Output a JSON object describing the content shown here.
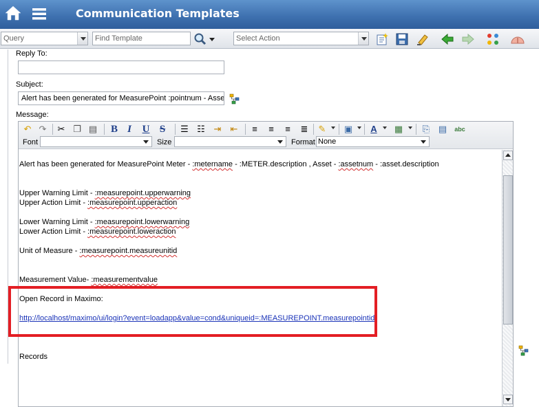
{
  "app": {
    "title": "Communication Templates",
    "home_icon": "home-icon",
    "menu_icon": "hamburger-menu-icon"
  },
  "toolbar": {
    "query_placeholder": "Query",
    "find_placeholder": "Find Template",
    "action_placeholder": "Select Action"
  },
  "form": {
    "reply_to_label": "Reply To:",
    "reply_to_value": "",
    "subject_label": "Subject:",
    "subject_value": "Alert has been generated for MeasurePoint :pointnum - Asset",
    "message_label": "Message:"
  },
  "editor": {
    "font_label": "Font",
    "font_value": "",
    "size_label": "Size",
    "size_value": "",
    "format_label": "Format",
    "format_value": "None",
    "body": {
      "line1_prefix": "Alert has been generated for MeasurePoint Meter - ",
      "line1_metername": ":metername",
      "line1_mid": " - :METER.description  , Asset - ",
      "line1_assetnum": ":assetnum",
      "line1_suffix": " - :asset.description",
      "upper_warning_label": "Upper Warning Limit - ",
      "upper_warning_var": ":measurepoint.upperwarning",
      "upper_action_label": "Upper Action Limit - ",
      "upper_action_var": ":measurepoint.upperaction",
      "lower_warning_label": "Lower Warning Limit - ",
      "lower_warning_var": ":measurepoint.lowerwarning",
      "lower_action_label": "Lower Action Limit - ",
      "lower_action_var": ":measurepoint.loweraction",
      "uom_label": "Unit of Measure - ",
      "uom_var": ":measurepoint.measureunitid",
      "mv_label": "Measurement Value- ",
      "mv_var": ":measurementvalue",
      "open_record": "Open Record in Maximo:",
      "link": "http://localhost/maximo/ui/login?event=loadapp&value=cond&uniqueid=:MEASUREPOINT.measurepointid",
      "records": "Records"
    }
  },
  "colors": {
    "highlight": "#e31e24",
    "titlebar": "#3d6fae",
    "link": "#1a33b8"
  }
}
